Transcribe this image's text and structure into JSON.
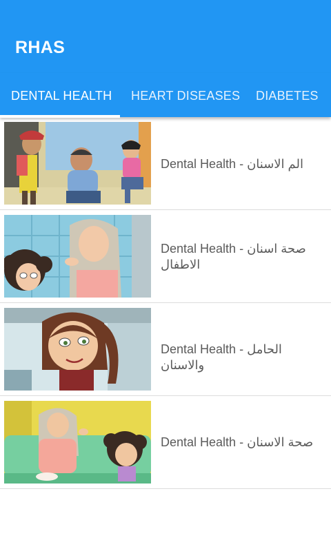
{
  "app": {
    "title": "RHAS"
  },
  "tabs": [
    {
      "label": "DENTAL HEALTH",
      "selected": true
    },
    {
      "label": "HEART DISEASES",
      "selected": false
    },
    {
      "label": "DIABETES",
      "selected": false
    }
  ],
  "videos": [
    {
      "title": "Dental Health - الم الاسنان",
      "thumbnail": "cartoon-family-room-thumbnail"
    },
    {
      "title": "Dental Health - صحة اسنان الاطفال",
      "thumbnail": "cartoon-mother-child-thumbnail"
    },
    {
      "title": "Dental Health - الحامل والاسنان",
      "thumbnail": "cartoon-girl-thumbnail"
    },
    {
      "title": "Dental Health - صحة الاسنان",
      "thumbnail": "cartoon-mother-daughter-couch-thumbnail"
    }
  ]
}
